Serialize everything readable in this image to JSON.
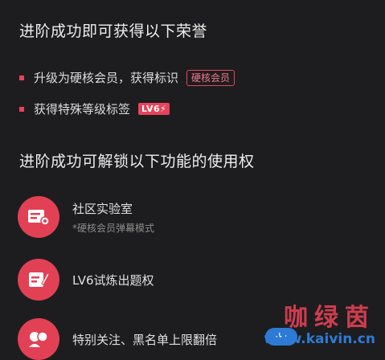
{
  "section1": {
    "title": "进阶成功即可获得以下荣誉",
    "items": [
      {
        "text": "升级为硬核会员，获得标识",
        "tag": "硬核会员"
      },
      {
        "text": "获得特殊等级标签",
        "badge": "LV6⚡"
      }
    ]
  },
  "section2": {
    "title": "进阶成功可解锁以下功能的使用权",
    "features": [
      {
        "title": "社区实验室",
        "subtitle": "*硬核会员弹幕模式",
        "icon": "lab-icon"
      },
      {
        "title": "LV6试炼出题权",
        "subtitle": "",
        "icon": "quiz-icon"
      },
      {
        "title": "特别关注、黑名单上限翻倍",
        "subtitle": "",
        "icon": "follow-icon"
      }
    ]
  },
  "watermark": {
    "name": "咖绿茵",
    "url": "www.kaivin.cn",
    "logo": "+·"
  },
  "colors": {
    "accent": "#e24155",
    "background": "#1d1d1f"
  }
}
